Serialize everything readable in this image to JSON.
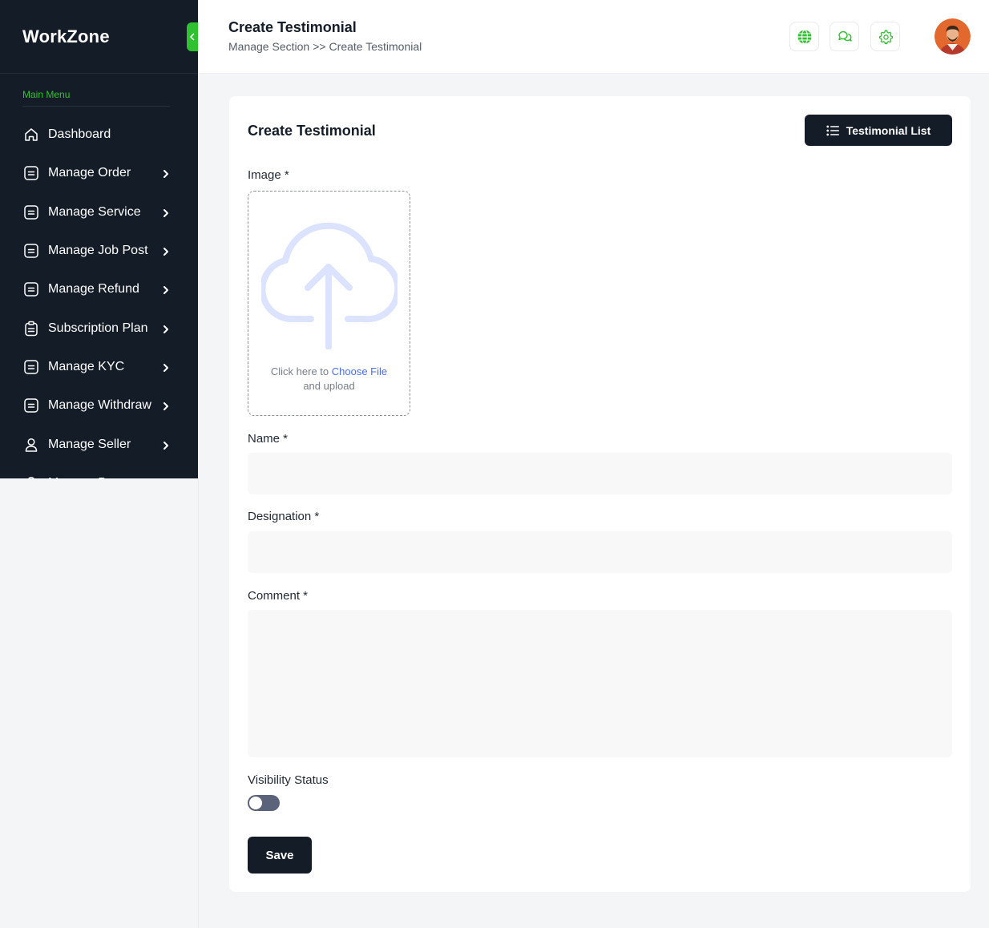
{
  "brand": "WorkZone",
  "sidebar": {
    "heading": "Main Menu",
    "items": [
      {
        "label": "Dashboard",
        "icon": "home-icon",
        "chevron": false
      },
      {
        "label": "Manage Order",
        "icon": "list-box-icon",
        "chevron": true
      },
      {
        "label": "Manage Service",
        "icon": "list-box-icon",
        "chevron": true
      },
      {
        "label": "Manage Job Post",
        "icon": "list-box-icon",
        "chevron": true
      },
      {
        "label": "Manage Refund",
        "icon": "list-box-icon",
        "chevron": true
      },
      {
        "label": "Subscription Plan",
        "icon": "clipboard-icon",
        "chevron": true
      },
      {
        "label": "Manage KYC",
        "icon": "list-box-icon",
        "chevron": true
      },
      {
        "label": "Manage Withdraw",
        "icon": "list-box-icon",
        "chevron": true
      },
      {
        "label": "Manage Seller",
        "icon": "user-icon",
        "chevron": true
      },
      {
        "label": "Manage Buyer",
        "icon": "user-icon",
        "chevron": true
      }
    ]
  },
  "header": {
    "title": "Create Testimonial",
    "breadcrumb": {
      "parent": "Manage Section",
      "separator": ">>",
      "current": "Create Testimonial"
    },
    "icons": [
      "globe-icon",
      "chat-icon",
      "settings-icon"
    ]
  },
  "form": {
    "title": "Create Testimonial",
    "list_button": "Testimonial List",
    "image_label": "Image *",
    "upload": {
      "prefix": "Click here to",
      "link": "Choose File",
      "suffix": "and upload"
    },
    "name_label": "Name *",
    "name_value": "",
    "designation_label": "Designation *",
    "designation_value": "",
    "comment_label": "Comment *",
    "comment_value": "",
    "visibility_label": "Visibility Status",
    "visibility_on": false,
    "save_label": "Save"
  },
  "colors": {
    "accent": "#2fc12f",
    "dark": "#141d27",
    "link": "#4b6ef5"
  }
}
